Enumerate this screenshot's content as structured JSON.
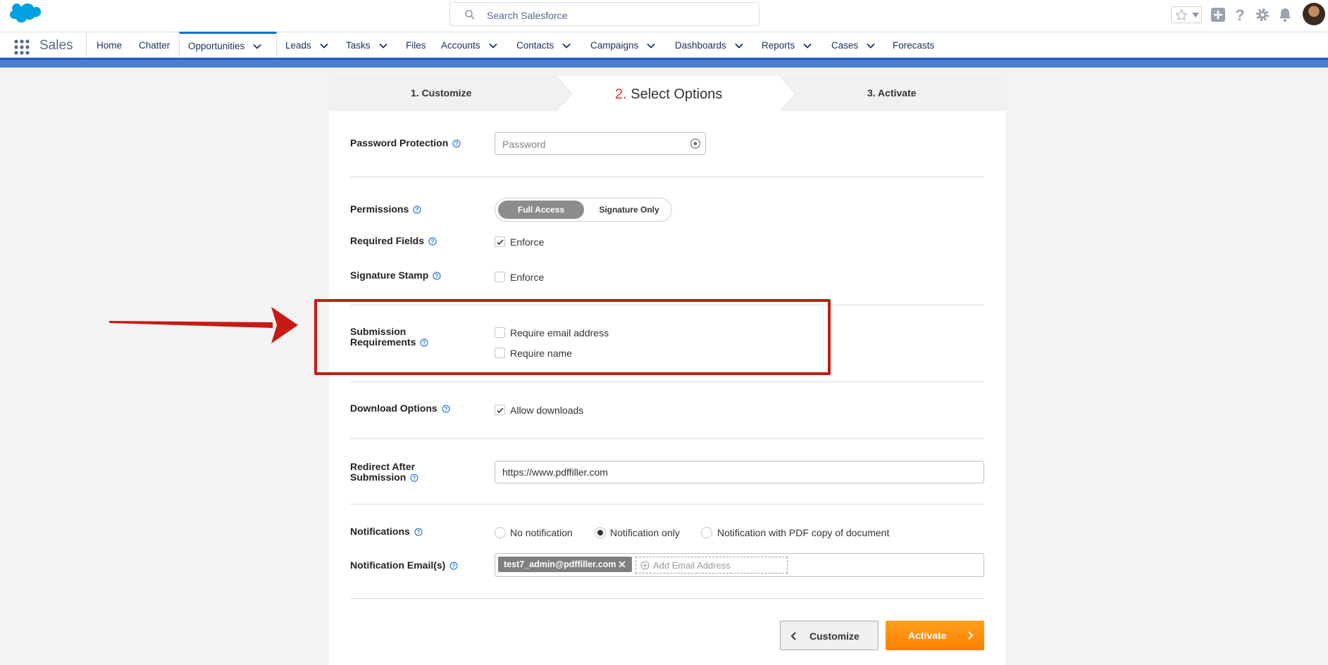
{
  "header": {
    "search_placeholder": "Search Salesforce",
    "app_name": "Sales"
  },
  "nav": {
    "items": [
      {
        "label": "Home",
        "dropdown": false
      },
      {
        "label": "Chatter",
        "dropdown": false
      },
      {
        "label": "Opportunities",
        "dropdown": true,
        "active": true
      },
      {
        "label": "Leads",
        "dropdown": true
      },
      {
        "label": "Tasks",
        "dropdown": true
      },
      {
        "label": "Files",
        "dropdown": false
      },
      {
        "label": "Accounts",
        "dropdown": true
      },
      {
        "label": "Contacts",
        "dropdown": true
      },
      {
        "label": "Campaigns",
        "dropdown": true
      },
      {
        "label": "Dashboards",
        "dropdown": true
      },
      {
        "label": "Reports",
        "dropdown": true
      },
      {
        "label": "Cases",
        "dropdown": true
      },
      {
        "label": "Forecasts",
        "dropdown": false
      }
    ]
  },
  "steps": {
    "step1": "1. Customize",
    "step2_num": "2.",
    "step2_label": "Select Options",
    "step3": "3. Activate"
  },
  "form": {
    "password": {
      "label": "Password Protection",
      "placeholder": "Password"
    },
    "permissions": {
      "label": "Permissions",
      "option_on": "Full Access",
      "option_off": "Signature Only"
    },
    "required_fields": {
      "label": "Required Fields",
      "option": "Enforce",
      "checked": true
    },
    "signature_stamp": {
      "label": "Signature Stamp",
      "option": "Enforce",
      "checked": false
    },
    "submission": {
      "label_line1": "Submission",
      "label_line2": "Requirements",
      "email": "Require email address",
      "name": "Require name"
    },
    "download": {
      "label": "Download Options",
      "option": "Allow downloads",
      "checked": true
    },
    "redirect": {
      "label_line1": "Redirect After",
      "label_line2": "Submission",
      "value": "https://www.pdffiller.com"
    },
    "notifications": {
      "label": "Notifications",
      "options": [
        "No notification",
        "Notification only",
        "Notification with PDF copy of document"
      ],
      "selected": "Notification only"
    },
    "emails": {
      "label": "Notification Email(s)",
      "tag": "test7_admin@pdffiller.com",
      "add_placeholder": "Add Email Address"
    }
  },
  "buttons": {
    "back": "Customize",
    "next": "Activate"
  },
  "colors": {
    "accent": "#0070d2",
    "activate": "#ff8c0a",
    "annotation": "#c71a14"
  }
}
